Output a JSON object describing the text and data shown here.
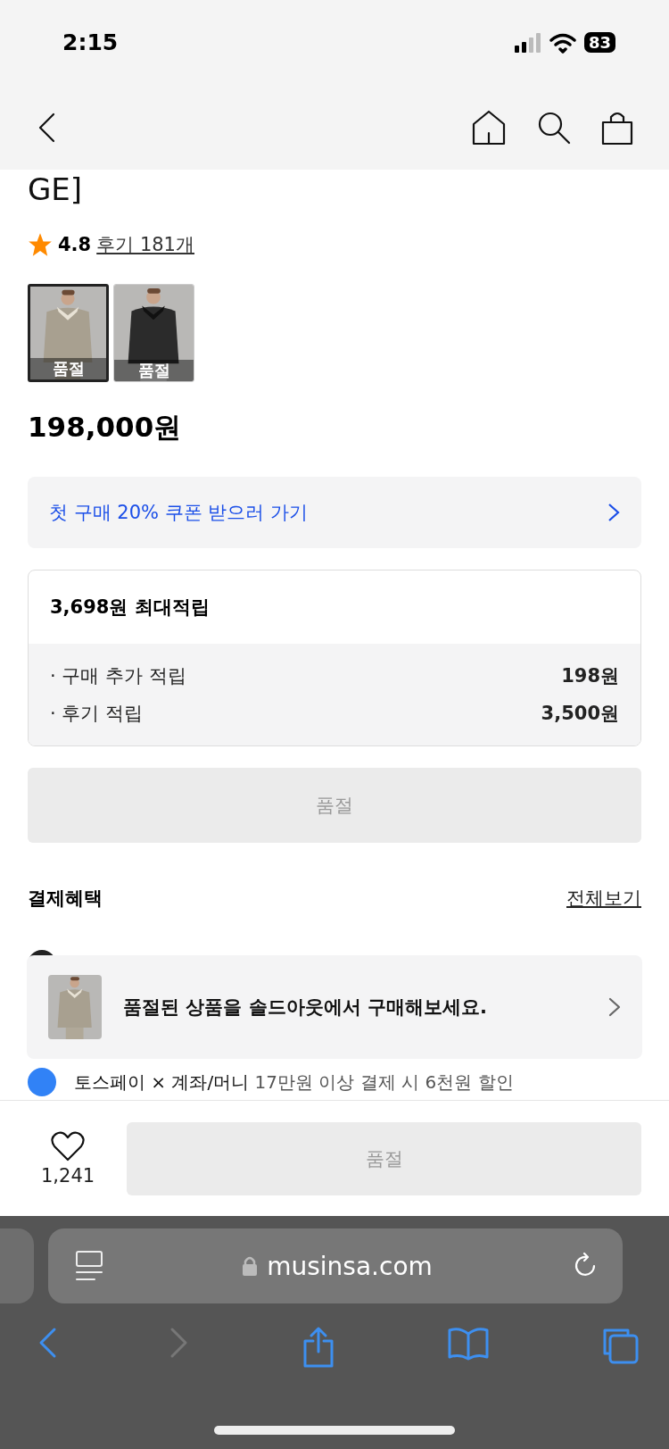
{
  "status_bar": {
    "time": "2:15",
    "battery": "83"
  },
  "product": {
    "title_fragment": "GE]",
    "rating": "4.8",
    "reviews": "후기 181개",
    "variants": [
      {
        "badge": "품절",
        "selected": true
      },
      {
        "badge": "품절",
        "selected": false
      }
    ],
    "price": "198,000원"
  },
  "coupon": {
    "label": "첫 구매 20% 쿠폰 받으러 가기"
  },
  "points": {
    "title": "3,698원 최대적립",
    "rows": [
      {
        "label": "· 구매 추가 적립",
        "value": "198원"
      },
      {
        "label": "· 후기 적립",
        "value": "3,500원"
      }
    ]
  },
  "soldout_button": {
    "label": "품절",
    "disabled": true
  },
  "payment_benefits": {
    "title": "결제혜택",
    "view_all": "전체보기",
    "items": [
      {
        "brand": "토스페이 × 계좌/머니",
        "detail": "17만원 이상 결제 시 6천원 할인",
        "color": "#3182f6"
      }
    ]
  },
  "soldout_banner": {
    "text": "품절된 상품을 솔드아웃에서 구매해보세요."
  },
  "bottom_bar": {
    "likes": "1,241",
    "button": "품절"
  },
  "browser": {
    "url": "musinsa.com"
  }
}
